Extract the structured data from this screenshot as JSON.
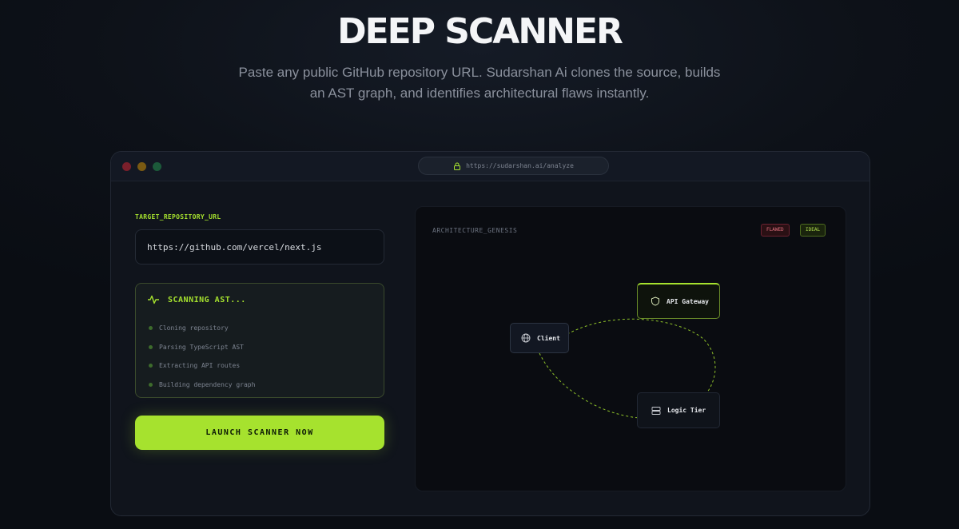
{
  "hero": {
    "title": "DEEP SCANNER",
    "subtitle": "Paste any public GitHub repository URL. Sudarshan Ai clones the source, builds an AST graph, and identifies architectural flaws instantly."
  },
  "browser": {
    "url": "https://sudarshan.ai/analyze",
    "lock_icon": "lock-icon"
  },
  "form": {
    "label": "TARGET_REPOSITORY_URL",
    "repo_url": "https://github.com/vercel/next.js",
    "scan_status": "SCANNING AST...",
    "steps": [
      "Cloning repository",
      "Parsing TypeScript AST",
      "Extracting API routes",
      "Building dependency graph"
    ],
    "launch_label": "LAUNCH SCANNER NOW"
  },
  "architecture": {
    "title": "ARCHITECTURE_GENESIS",
    "badges": {
      "flawed": "FLAWED",
      "ideal": "IDEAL"
    },
    "nodes": {
      "client": "Client",
      "gateway": "API Gateway",
      "logic": "Logic Tier"
    }
  },
  "colors": {
    "accent": "#a6e22e",
    "background": "#0b0e14",
    "flawed": "#e0707e"
  }
}
